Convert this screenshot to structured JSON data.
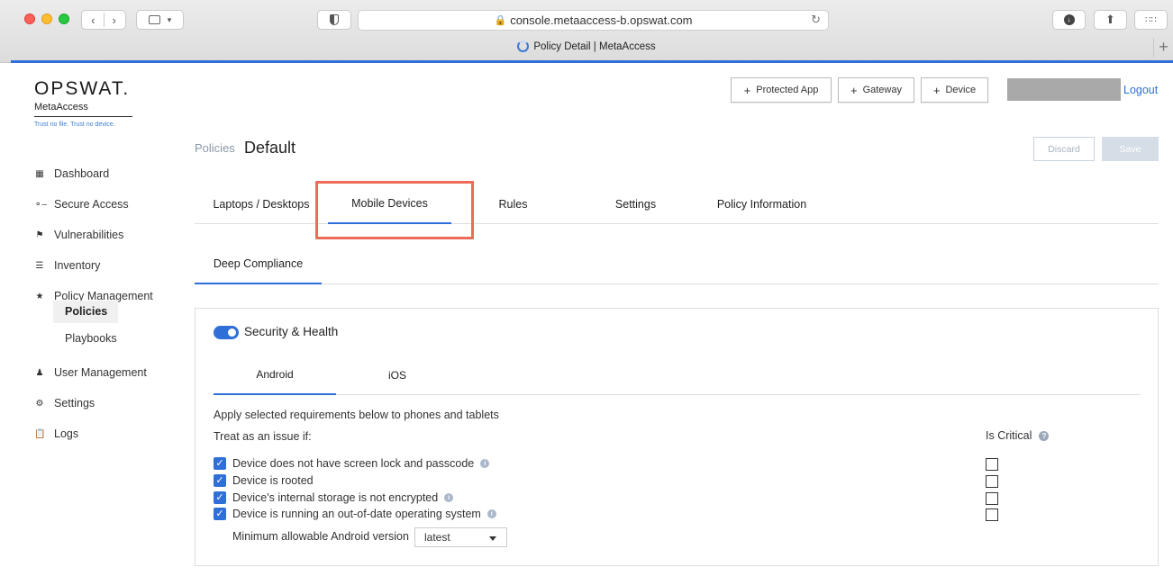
{
  "browser": {
    "url": "console.metaaccess-b.opswat.com",
    "tab_title": "Policy Detail | MetaAccess"
  },
  "brand": {
    "logo": "OPSWAT.",
    "product": "MetaAccess",
    "tagline": "Trust no file. Trust no device."
  },
  "header": {
    "buttons": [
      "Protected App",
      "Gateway",
      "Device"
    ],
    "logout": "Logout"
  },
  "sidebar": {
    "items": [
      {
        "label": "Dashboard",
        "icon": "grid-icon"
      },
      {
        "label": "Secure Access",
        "icon": "key-icon"
      },
      {
        "label": "Vulnerabilities",
        "icon": "flag-icon"
      },
      {
        "label": "Inventory",
        "icon": "list-icon"
      },
      {
        "label": "Policy Management",
        "icon": "star-icon"
      },
      {
        "label": "User Management",
        "icon": "users-icon"
      },
      {
        "label": "Settings",
        "icon": "gear-icon"
      },
      {
        "label": "Logs",
        "icon": "clipboard-icon"
      }
    ],
    "subitems": [
      "Policies",
      "Playbooks"
    ]
  },
  "page": {
    "breadcrumb": "Policies",
    "title": "Default",
    "discard": "Discard",
    "save": "Save"
  },
  "tabs": [
    "Laptops / Desktops",
    "Mobile Devices",
    "Rules",
    "Settings",
    "Policy Information"
  ],
  "subtab": "Deep Compliance",
  "panel": {
    "section_title": "Security & Health",
    "os_tabs": [
      "Android",
      "iOS"
    ],
    "intro": "Apply selected requirements below to phones and tablets",
    "treat_label": "Treat as an issue if:",
    "critical_label": "Is Critical",
    "requirements": [
      "Device does not have screen lock and passcode",
      "Device is rooted",
      "Device's internal storage is not encrypted",
      "Device is running an out-of-date operating system"
    ],
    "min_version_label": "Minimum allowable Android version",
    "min_version_value": "latest"
  }
}
